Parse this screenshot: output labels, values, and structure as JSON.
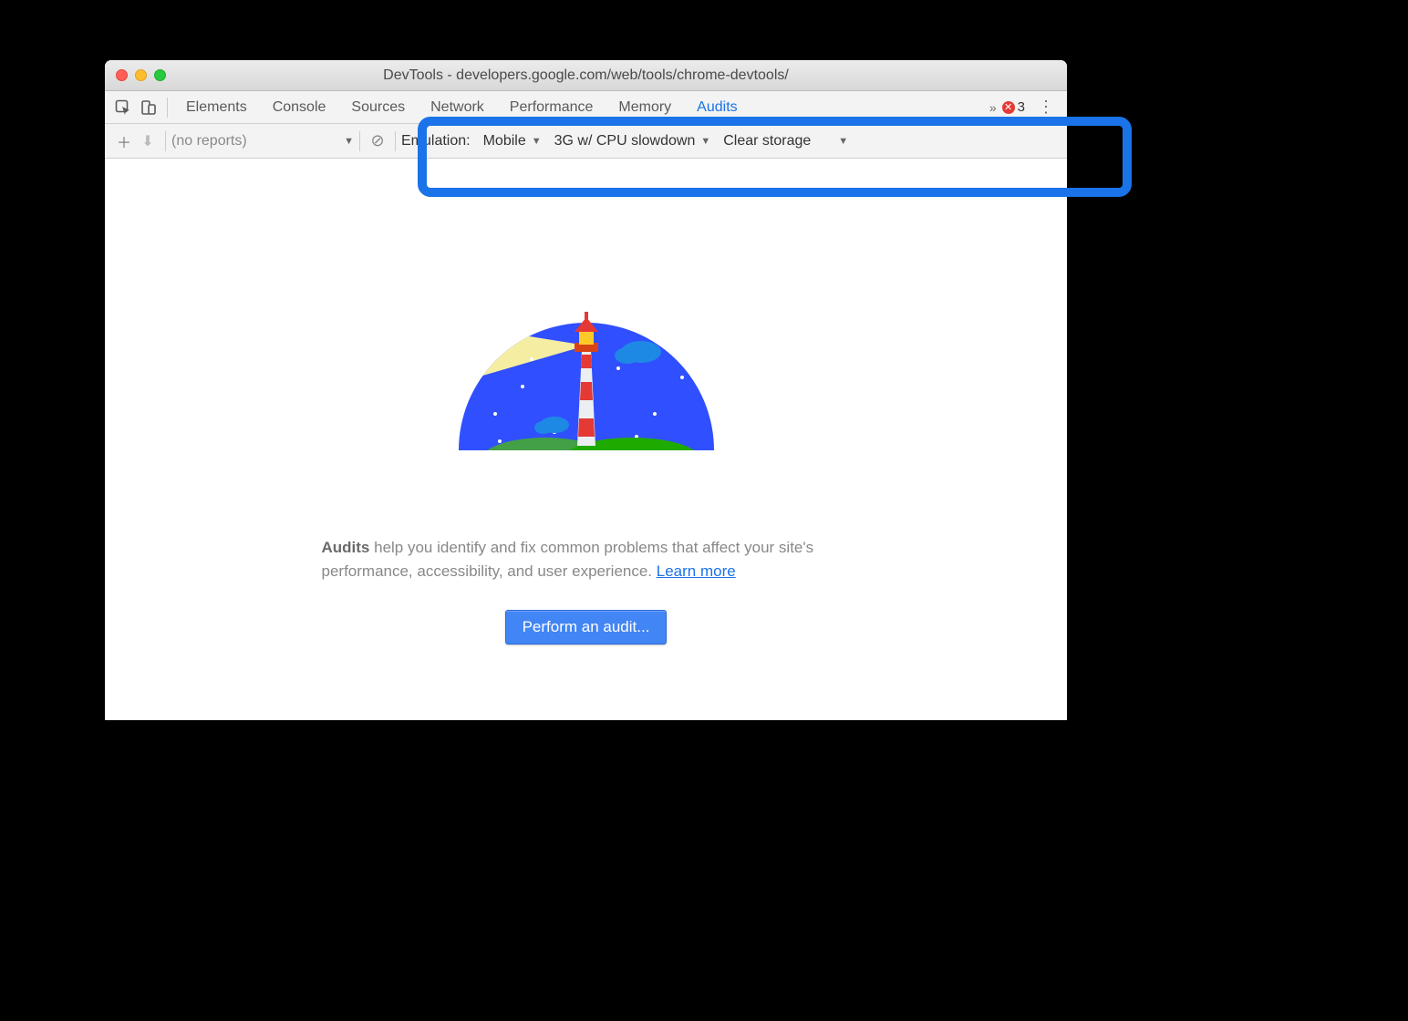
{
  "window": {
    "title": "DevTools - developers.google.com/web/tools/chrome-devtools/"
  },
  "tabs": {
    "items": [
      "Elements",
      "Console",
      "Sources",
      "Network",
      "Performance",
      "Memory",
      "Audits"
    ],
    "overflow_glyph": "»",
    "error_count": "3",
    "kebab_glyph": "⋮"
  },
  "toolbar": {
    "add_glyph": "＋",
    "download_glyph": "⬇",
    "reports_placeholder": "(no reports)",
    "clear_glyph": "⊘",
    "emulation_label": "Emulation:",
    "emulation_value": "Mobile",
    "throttle_value": "3G w/ CPU slowdown",
    "storage_value": "Clear storage"
  },
  "content": {
    "heading_strong": "Audits",
    "desc_part1": " help you identify and fix common problems that affect your site's performance, accessibility, and user experience. ",
    "learn_more": "Learn more",
    "button_label": "Perform an audit..."
  }
}
